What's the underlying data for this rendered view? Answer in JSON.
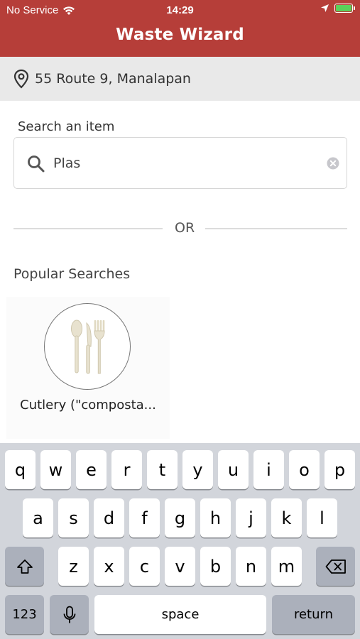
{
  "status_bar": {
    "carrier": "No Service",
    "time": "14:29"
  },
  "header": {
    "title": "Waste Wizard",
    "background": "#b63e39"
  },
  "location": {
    "address": "55 Route 9, Manalapan",
    "icon": "location-pin-icon"
  },
  "search": {
    "label": "Search an item",
    "value": "Plas",
    "icon": "search-icon",
    "clear_icon": "clear-icon"
  },
  "divider": {
    "text": "OR"
  },
  "popular": {
    "label": "Popular Searches",
    "items": [
      {
        "name": "Cutlery (\"composta...",
        "icon": "cutlery-icon"
      }
    ]
  },
  "keyboard": {
    "row1": [
      "q",
      "w",
      "e",
      "r",
      "t",
      "y",
      "u",
      "i",
      "o",
      "p"
    ],
    "row2": [
      "a",
      "s",
      "d",
      "f",
      "g",
      "h",
      "j",
      "k",
      "l"
    ],
    "row3": [
      "z",
      "x",
      "c",
      "v",
      "b",
      "n",
      "m"
    ],
    "numbers_label": "123",
    "space_label": "space",
    "return_label": "return"
  }
}
